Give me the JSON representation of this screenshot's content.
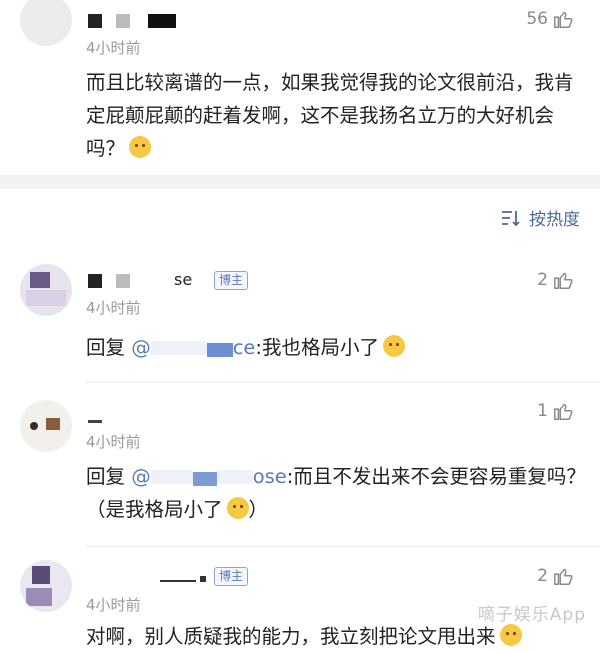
{
  "comments": [
    {
      "time": "4小时前",
      "likes": "56",
      "text": "而且比较离谱的一点，如果我觉得我的论文很前沿，我肯定屁颠屁颠的赶着发啊，这不是我扬名立万的大好机会吗？"
    },
    {
      "name_partial": "se",
      "badge": "博主",
      "time": "4小时前",
      "likes": "2",
      "reply_prefix": "回复 ",
      "reply_mention_start": "@",
      "reply_mention_end": "ce",
      "reply_text": ":我也格局小了"
    },
    {
      "time": "4小时前",
      "likes": "1",
      "reply_prefix": "回复 ",
      "reply_mention_start": "@",
      "reply_mention_end": "ose",
      "reply_text": ":而且不发出来不会更容易重复吗？（是我格局小了",
      "reply_close": "）"
    },
    {
      "badge": "博主",
      "time": "4小时前",
      "likes": "2",
      "text": "对啊，别人质疑我的能力，我立刻把论文甩出来"
    }
  ],
  "sort": {
    "label": "按热度",
    "icon": "sort-icon"
  },
  "icons": {
    "like": "thumbs-up-icon"
  },
  "colors": {
    "link": "#5a7bb5",
    "muted": "#9a9a9a"
  },
  "watermark": "嘀子娱乐App"
}
